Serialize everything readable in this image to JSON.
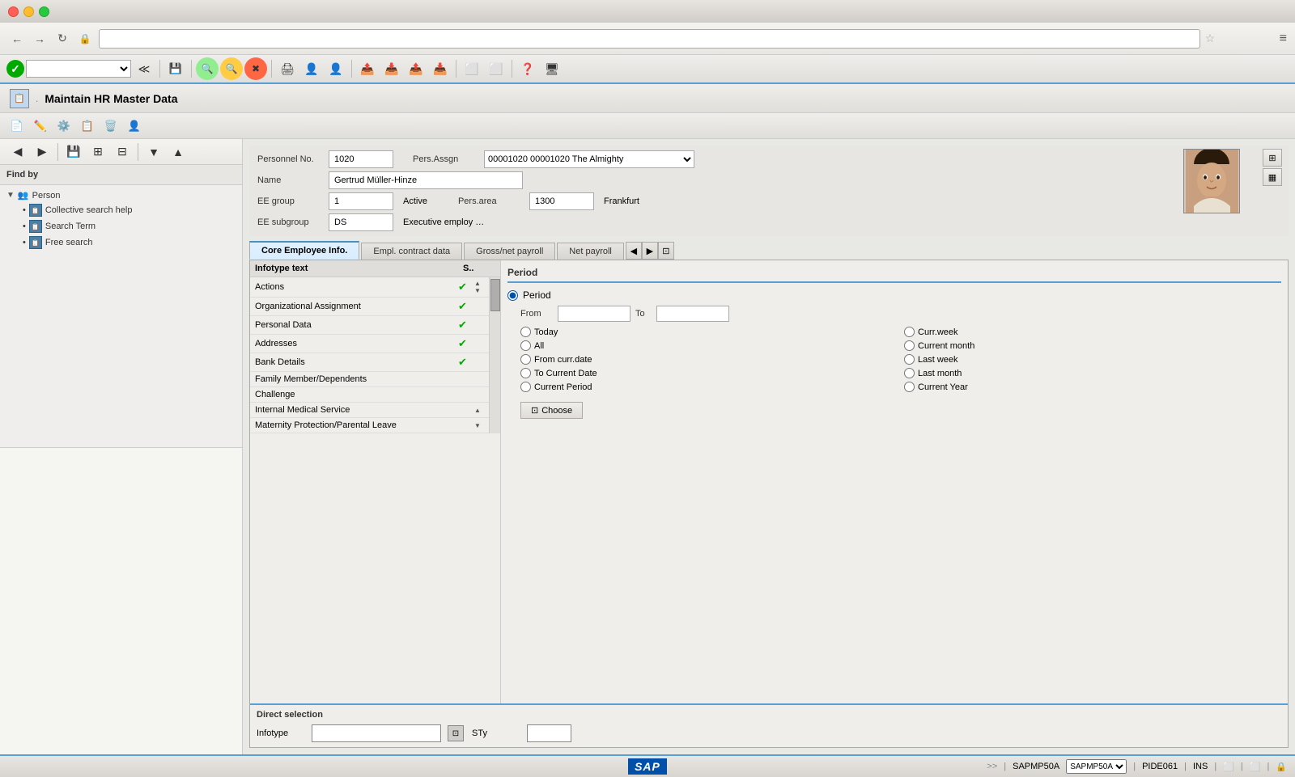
{
  "titlebar": {
    "title": ""
  },
  "browser": {
    "url": "",
    "back": "←",
    "forward": "→",
    "refresh": "↻",
    "lock": "🔒"
  },
  "sap_toolbar": {
    "dropdown_placeholder": "",
    "icons": [
      "≪",
      "💾",
      "🔍",
      "🔍",
      "✖",
      "|",
      "🖨",
      "👤",
      "👤",
      "|",
      "📤",
      "📥",
      "📤",
      "📥",
      "|",
      "📋",
      "📋",
      "|",
      "❓",
      "🖥"
    ]
  },
  "app_title": {
    "title": "Maintain HR Master Data",
    "icon": "📋"
  },
  "second_toolbar": {
    "icons": [
      "📄",
      "✏️",
      "⚙️",
      "📋",
      "🗑️",
      "👤"
    ]
  },
  "left_panel": {
    "find_by": "Find by",
    "tree": {
      "person_label": "Person",
      "children": [
        {
          "label": "Collective search help",
          "icon": "📋"
        },
        {
          "label": "Search Term",
          "icon": "📋"
        },
        {
          "label": "Free search",
          "icon": "📋"
        }
      ]
    }
  },
  "personnel": {
    "personnel_no_label": "Personnel No.",
    "personnel_no_value": "1020",
    "pers_assn_label": "Pers.Assgn",
    "pers_assn_value": "00001020 00001020 The Almighty",
    "name_label": "Name",
    "name_value": "Gertrud Müller-Hinze",
    "ee_group_label": "EE group",
    "ee_group_code": "1",
    "ee_group_value": "Active",
    "pers_area_label": "Pers.area",
    "pers_area_code": "1300",
    "pers_area_value": "Frankfurt",
    "ee_subgroup_label": "EE subgroup",
    "ee_subgroup_code": "DS",
    "ee_subgroup_value": "Executive employ …"
  },
  "tabs": [
    {
      "label": "Core Employee Info.",
      "active": true
    },
    {
      "label": "Empl. contract data",
      "active": false
    },
    {
      "label": "Gross/net payroll",
      "active": false
    },
    {
      "label": "Net payroll",
      "active": false
    }
  ],
  "infotypes": {
    "header_text": "Infotype text",
    "header_s": "S..",
    "rows": [
      {
        "name": "Actions",
        "check": true
      },
      {
        "name": "Organizational Assignment",
        "check": true
      },
      {
        "name": "Personal Data",
        "check": true
      },
      {
        "name": "Addresses",
        "check": true
      },
      {
        "name": "Bank Details",
        "check": true
      },
      {
        "name": "Family Member/Dependents",
        "check": false
      },
      {
        "name": "Challenge",
        "check": false
      },
      {
        "name": "Internal Medical Service",
        "check": false
      },
      {
        "name": "Maternity Protection/Parental Leave",
        "check": false
      }
    ]
  },
  "period": {
    "header": "Period",
    "period_radio_label": "Period",
    "from_label": "From",
    "to_label": "To",
    "from_value": "",
    "to_value": "",
    "options": [
      {
        "label": "Today",
        "col": 1
      },
      {
        "label": "Curr.week",
        "col": 2
      },
      {
        "label": "All",
        "col": 1
      },
      {
        "label": "Current month",
        "col": 2
      },
      {
        "label": "From curr.date",
        "col": 1
      },
      {
        "label": "Last week",
        "col": 2
      },
      {
        "label": "To Current Date",
        "col": 1
      },
      {
        "label": "Last month",
        "col": 2
      },
      {
        "label": "Current Period",
        "col": 1
      },
      {
        "label": "Current Year",
        "col": 2
      }
    ],
    "choose_label": "Choose"
  },
  "direct_selection": {
    "header": "Direct selection",
    "infotype_label": "Infotype",
    "sty_label": "STy",
    "infotype_value": "",
    "sty_value": ""
  },
  "status_bar": {
    "sap_label": "SAP",
    "program": "SAPMP50A",
    "transaction": "PIDE061",
    "mode": "INS"
  }
}
